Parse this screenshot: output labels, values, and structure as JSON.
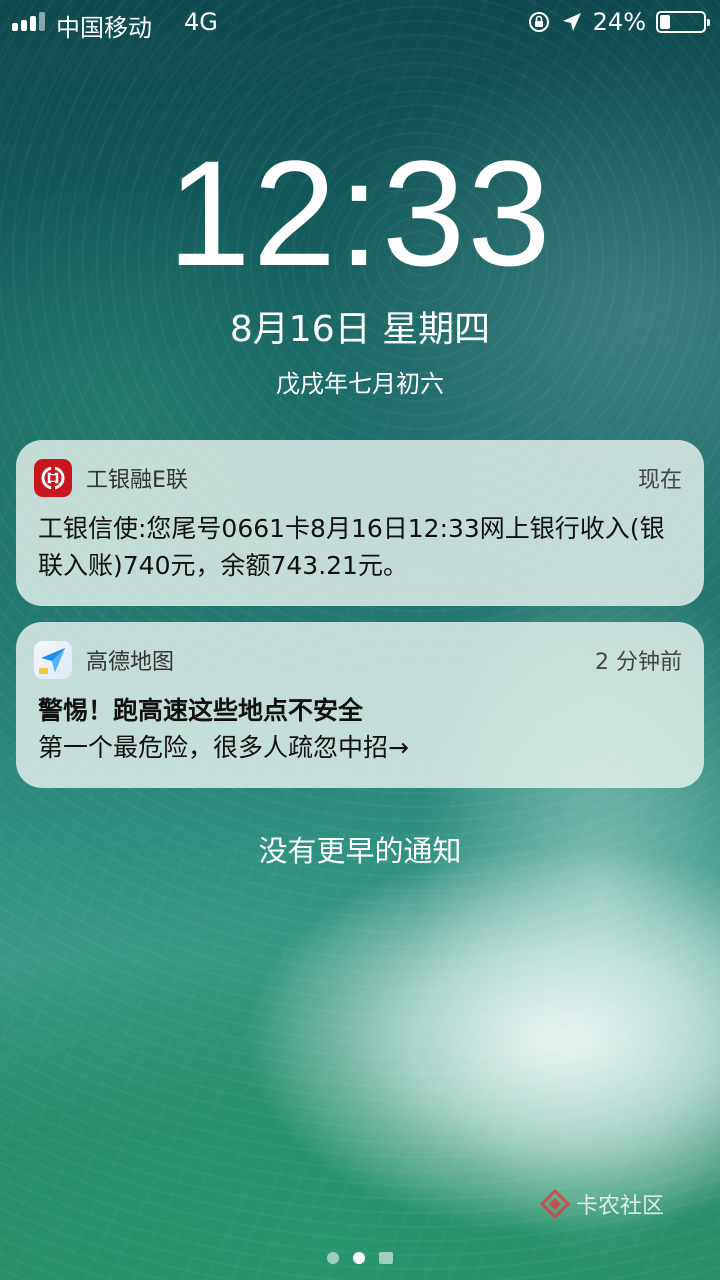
{
  "status_bar": {
    "carrier": "中国移动",
    "network": "4G",
    "battery_percent": "24%",
    "battery_level": 0.24,
    "icons": [
      "signal-icon",
      "rotation-lock-icon",
      "location-arrow-icon",
      "battery-icon"
    ]
  },
  "lock_screen": {
    "time": "12:33",
    "date": "8月16日 星期四",
    "lunar_date": "戊戌年七月初六"
  },
  "notifications": [
    {
      "app": "工银融E联",
      "icon": "icbc-icon",
      "time": "现在",
      "body": "工银信使:您尾号0661卡8月16日12:33网上银行收入(银联入账)740元，余额743.21元。"
    },
    {
      "app": "高德地图",
      "icon": "amap-icon",
      "time": "2 分钟前",
      "title": "警惕！跑高速这些地点不安全",
      "body": "第一个最危险，很多人疏忽中招→"
    }
  ],
  "no_more_notifications": "没有更早的通知",
  "watermark": "卡农社区",
  "colors": {
    "icbc_red": "#c8161d",
    "amap_blue": "#1e8ee8"
  }
}
